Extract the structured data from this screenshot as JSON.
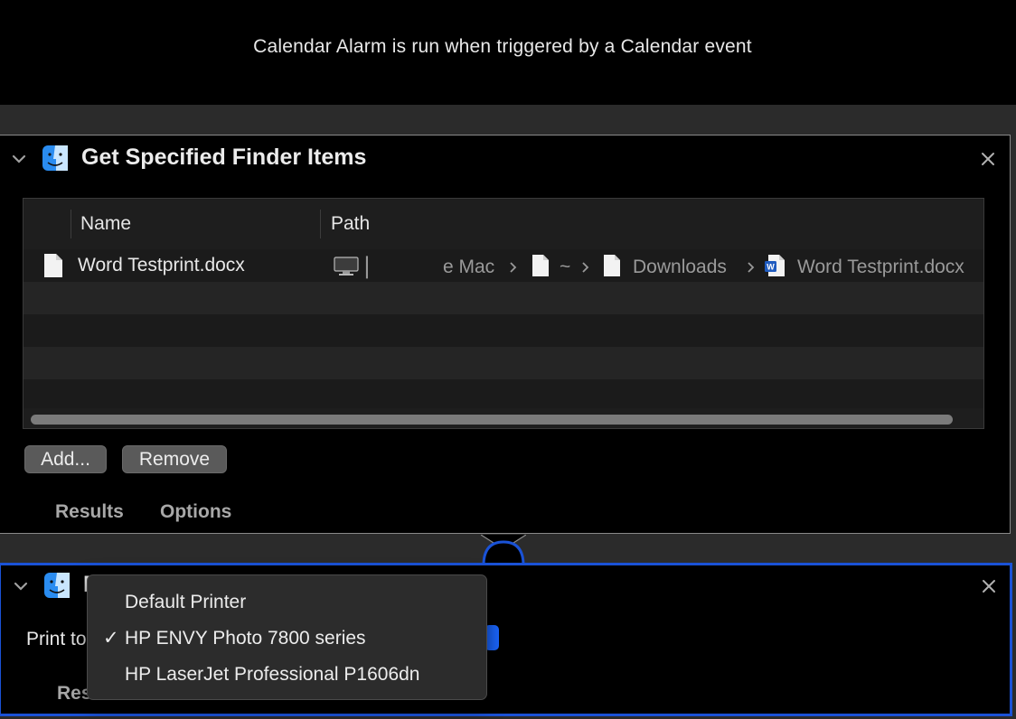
{
  "header": {
    "text": "Calendar Alarm is run when triggered by a Calendar event"
  },
  "action1": {
    "title": "Get Specified Finder Items",
    "columns": [
      "Name",
      "Path"
    ],
    "rows": [
      {
        "name": "Word Testprint.docx",
        "path_segments": [
          "▏",
          "e Mac",
          "~",
          "Downloads",
          "Word Testprint.docx"
        ]
      }
    ],
    "buttons": {
      "add": "Add...",
      "remove": "Remove"
    },
    "tabs": {
      "results": "Results",
      "options": "Options"
    }
  },
  "action2": {
    "title_partial": "P",
    "print_to_label": "Print to",
    "tab_results": "Results"
  },
  "menu": {
    "items": [
      {
        "label": "Default Printer",
        "checked": false
      },
      {
        "label": "HP ENVY Photo 7800 series",
        "checked": true
      },
      {
        "label": "HP LaserJet Professional P1606dn",
        "checked": false
      }
    ],
    "checkmark": "✓"
  },
  "colors": {
    "selected_border": "#1a52d6",
    "background": "#000000"
  },
  "icons": {
    "collapse": "chevron-down-icon",
    "app": "finder-icon",
    "close": "close-icon",
    "file": "document-icon",
    "computer": "computer-icon",
    "word": "word-document-icon"
  }
}
